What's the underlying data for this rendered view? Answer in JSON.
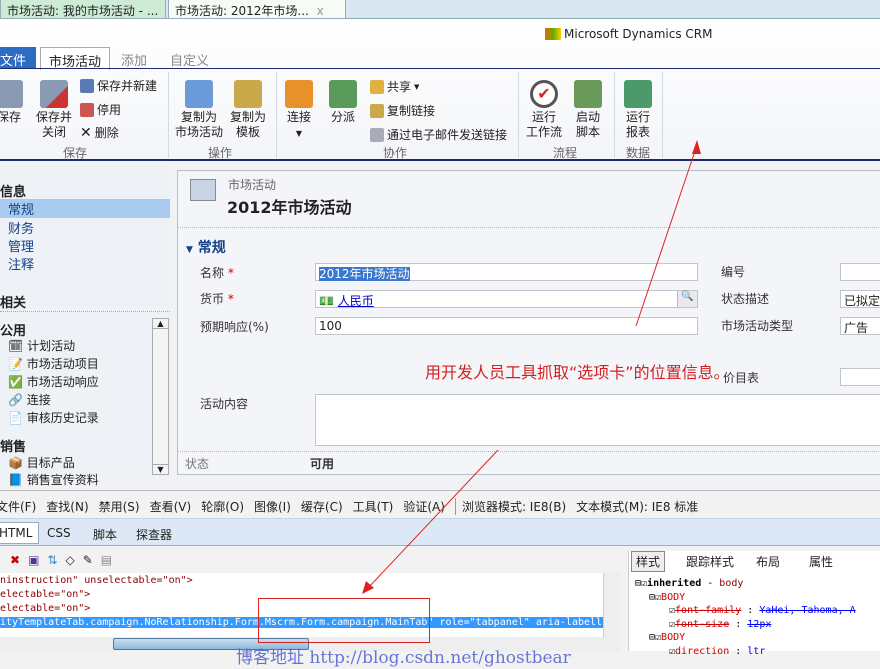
{
  "browser_tabs": [
    "市场活动: 我的市场活动 - ...",
    "市场活动: 2012年市场..."
  ],
  "brand": "Microsoft Dynamics CRM",
  "ribbon_tabs": [
    "文件",
    "市场活动",
    "添加",
    "自定义"
  ],
  "ribbon": {
    "save": "保存",
    "save_close": [
      "保存并",
      "关闭"
    ],
    "save_new": "保存并新建",
    "deactivate": "停用",
    "delete": "删除",
    "group_save": "保存",
    "copy_campaign": [
      "复制为",
      "市场活动"
    ],
    "copy_template": [
      "复制为",
      "模板"
    ],
    "group_action": "操作",
    "connect": "连接",
    "assign": "分派",
    "share": "共享",
    "copy_link": "复制链接",
    "email_link": "通过电子邮件发送链接",
    "group_collab": "协作",
    "run_workflow": [
      "运行",
      "工作流"
    ],
    "start_dialog": [
      "启动",
      "脚本"
    ],
    "group_process": "流程",
    "run_report": [
      "运行",
      "报表"
    ],
    "group_data": "数据"
  },
  "nav": {
    "info": "信息",
    "info_items": [
      "常规",
      "财务",
      "管理",
      "注释"
    ],
    "related": "相关",
    "common": "公用",
    "common_items": [
      "计划活动",
      "市场活动项目",
      "市场活动响应",
      "连接",
      "审核历史记录"
    ],
    "sales": "销售",
    "sales_items": [
      "目标产品",
      "销售宣传资料"
    ]
  },
  "form": {
    "entity": "市场活动",
    "title": "2012年市场活动",
    "section": "常规",
    "name_label": "名称",
    "name_value": "2012年市场活动",
    "currency_label": "货币",
    "currency_value": "人民币",
    "response_label": "预期响应(%)",
    "response_value": "100",
    "content_label": "活动内容",
    "code_label": "编号",
    "status_reason_label": "状态描述",
    "status_reason_value": "已拟定",
    "type_label": "市场活动类型",
    "type_value": "广告",
    "pricelist_label": "价目表",
    "status_label": "状态",
    "status_value": "可用",
    "required": "*"
  },
  "annotation": "用开发人员工具抓取“选项卡”的位置信息。",
  "devtools": {
    "menu": [
      "文件(F)",
      "查找(N)",
      "禁用(S)",
      "查看(V)",
      "轮廓(O)",
      "图像(I)",
      "缓存(C)",
      "工具(T)",
      "验证(A)"
    ],
    "browser_mode": "浏览器模式: IE8(B)",
    "doc_mode": "文本模式(M): IE8 标准",
    "tabs": [
      "HTML",
      "CSS",
      "脚本",
      "探查器"
    ],
    "right_tabs": [
      "样式",
      "跟踪样式",
      "布局",
      "属性"
    ],
    "code_lines": [
      "ninstruction\" unselectable=\"on\">",
      "electable=\"on\">",
      "electable=\"on\">",
      "ityTemplateTab.campaign.NoRelationship.Form.Mscrm.Form.campaign.MainTab\" role=\"tabpanel\" aria-labell"
    ],
    "styles": [
      "inherited",
      "body",
      "BODY",
      "font-family",
      "YaHei, Tahoma, A",
      "font-size",
      "12px",
      "BODY",
      "direction",
      "ltr"
    ]
  },
  "watermark": "博客地址 http://blog.csdn.net/ghostbear"
}
